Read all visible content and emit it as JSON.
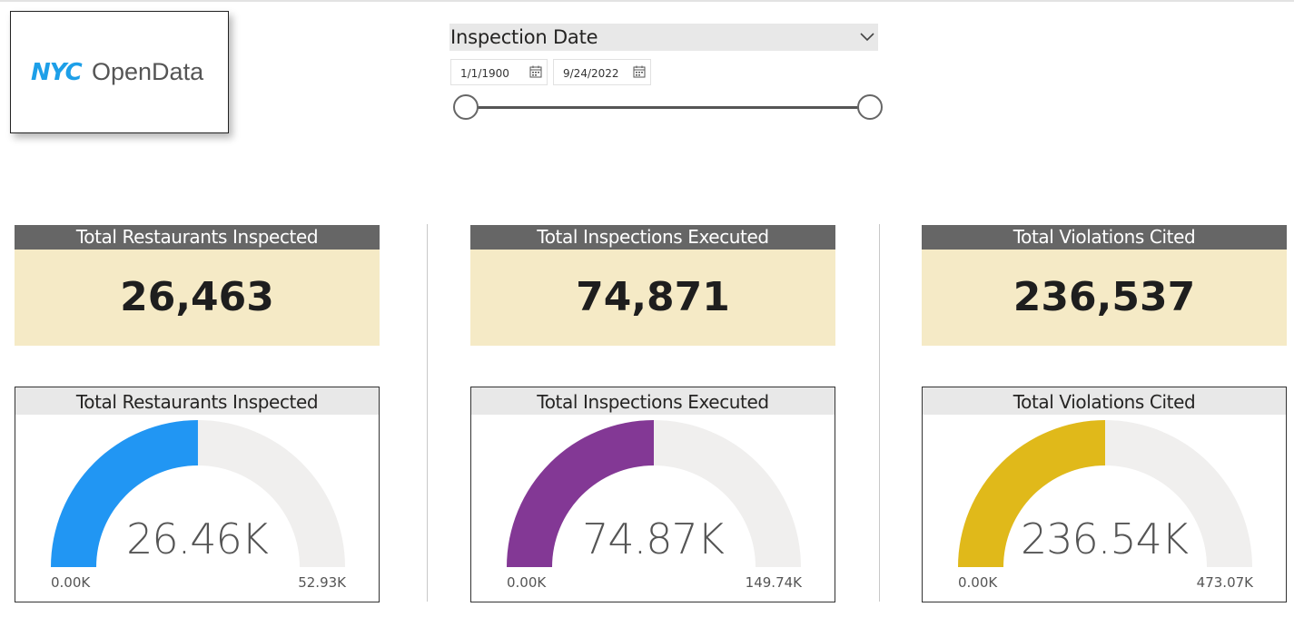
{
  "logo": {
    "text_nyc": "NYC",
    "text_open": "OpenData",
    "icon": "nyc-opendata-logo"
  },
  "slicer": {
    "title": "Inspection Date",
    "start_date": "1/1/1900",
    "end_date": "9/24/2022",
    "icons": {
      "dropdown": "chevron-down-icon",
      "calendar": "calendar-icon"
    }
  },
  "kpis": [
    {
      "title": "Total Restaurants Inspected",
      "value": "26,463"
    },
    {
      "title": "Total Inspections Executed",
      "value": "74,871"
    },
    {
      "title": "Total Violations Cited",
      "value": "236,537"
    }
  ],
  "gauges": [
    {
      "title": "Total Restaurants Inspected",
      "center_label": "26.46K",
      "min_label": "0.00K",
      "max_label": "52.93K",
      "value": 26.46,
      "min": 0,
      "max": 52.93,
      "color": "#2196f3"
    },
    {
      "title": "Total Inspections Executed",
      "center_label": "74.87K",
      "min_label": "0.00K",
      "max_label": "149.74K",
      "value": 74.87,
      "min": 0,
      "max": 149.74,
      "color": "#833895"
    },
    {
      "title": "Total Violations Cited",
      "center_label": "236.54K",
      "min_label": "0.00K",
      "max_label": "473.07K",
      "value": 236.54,
      "min": 0,
      "max": 473.07,
      "color": "#e0b91a"
    }
  ],
  "colors": {
    "kpi_header": "#666666",
    "kpi_body": "#f5eac6",
    "gauge_track": "#f0efee",
    "logo_blue": "#1d9fe8"
  }
}
